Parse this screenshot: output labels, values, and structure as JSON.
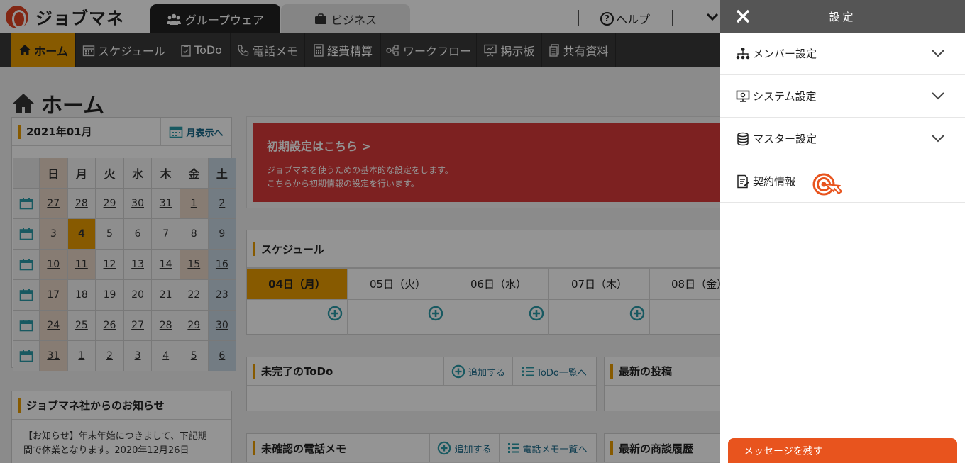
{
  "app": {
    "logo_text": "ジョブマネ"
  },
  "top_tabs": [
    {
      "label": "グループウェア",
      "icon": "group-icon"
    },
    {
      "label": "ビジネス",
      "icon": "briefcase-icon"
    }
  ],
  "help_label": "ヘルプ",
  "nav": [
    {
      "label": "ホーム",
      "icon": "home-icon"
    },
    {
      "label": "スケジュール",
      "icon": "calendar-icon"
    },
    {
      "label": "ToDo",
      "icon": "clipboard-icon"
    },
    {
      "label": "電話メモ",
      "icon": "phone-icon"
    },
    {
      "label": "経費精算",
      "icon": "calculator-icon"
    },
    {
      "label": "ワークフロー",
      "icon": "workflow-icon"
    },
    {
      "label": "掲示板",
      "icon": "board-icon"
    },
    {
      "label": "共有資料",
      "icon": "documents-icon"
    }
  ],
  "page_title": "ホーム",
  "calendar": {
    "month": "2021年01月",
    "month_view_link": "月表示へ",
    "weekdays": [
      "日",
      "月",
      "火",
      "水",
      "木",
      "金",
      "土"
    ],
    "weeks": [
      [
        "27",
        "28",
        "29",
        "30",
        "31",
        "1",
        "2"
      ],
      [
        "3",
        "4",
        "5",
        "6",
        "7",
        "8",
        "9"
      ],
      [
        "10",
        "11",
        "12",
        "13",
        "14",
        "15",
        "16"
      ],
      [
        "17",
        "18",
        "19",
        "20",
        "21",
        "22",
        "23"
      ],
      [
        "24",
        "25",
        "26",
        "27",
        "28",
        "29",
        "30"
      ],
      [
        "31",
        "1",
        "2",
        "3",
        "4",
        "5",
        "6"
      ]
    ],
    "today": "4"
  },
  "news": {
    "title": "ジョブマネ社からのお知らせ",
    "body_line1": "【お知らせ】年末年始につきまして、下記期",
    "body_line2": "間で休業となります。2020年12月26日"
  },
  "banner": {
    "title": "初期設定はこちら >",
    "line1": "ジョブマネを使うための基本的な設定をします。",
    "line2": "こちらから初期情報の設定を行います。"
  },
  "schedule": {
    "title": "スケジュール",
    "days": [
      "04日（月）",
      "05日（火）",
      "06日（水）",
      "07日（木）",
      "08日（金）"
    ]
  },
  "todo": {
    "title": "未完了のToDo",
    "add": "追加する",
    "list": "ToDo一覧へ"
  },
  "posts": {
    "title": "最新の投稿"
  },
  "phone_memo": {
    "title": "未確認の電話メモ",
    "add": "追加する",
    "list": "電話メモ一覧へ"
  },
  "deals": {
    "title": "最新の商談履歴"
  },
  "settings": {
    "title": "設定",
    "items": [
      {
        "label": "メンバー設定",
        "icon": "members-icon",
        "expandable": true
      },
      {
        "label": "システム設定",
        "icon": "system-icon",
        "expandable": true
      },
      {
        "label": "マスター設定",
        "icon": "database-icon",
        "expandable": true
      },
      {
        "label": "契約情報",
        "icon": "contract-icon",
        "expandable": false
      }
    ]
  },
  "message_button": "メッセージを残す",
  "colors": {
    "accent": "#e89b00",
    "banner": "#d83a3a",
    "cta": "#e8541e",
    "nav": "#3a3a3a"
  }
}
